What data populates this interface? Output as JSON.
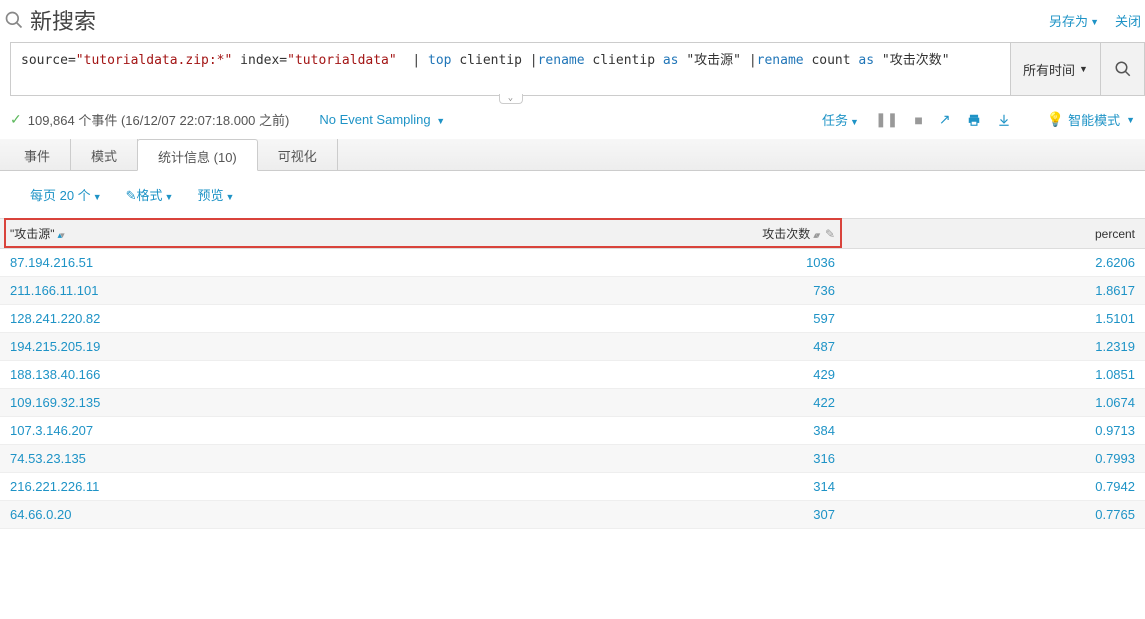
{
  "header": {
    "title": "新搜索",
    "save_as": "另存为",
    "close": "关闭"
  },
  "search": {
    "query_html": "source=<span class='kw-str'>\"tutorialdata.zip:*\"</span> index=<span class='kw-str'>\"tutorialdata\"</span>  | <span class='kw-cmd'>top</span> clientip |<span class='kw-cmd'>rename</span> clientip <span class='kw-cmd'>as</span> \"攻击源\" |<span class='kw-cmd'>rename</span> count <span class='kw-cmd'>as</span> \"攻击次数\"",
    "time_label": "所有时间"
  },
  "status": {
    "events_text": "109,864 个事件 (16/12/07 22:07:18.000 之前)",
    "sampling": "No Event Sampling",
    "tasks": "任务",
    "smart_mode": "智能模式"
  },
  "tabs": {
    "events": "事件",
    "patterns": "模式",
    "stats": "统计信息 (10)",
    "viz": "可视化"
  },
  "toolbar": {
    "per_page": "每页 20 个",
    "format": "格式",
    "preview": "预览"
  },
  "table": {
    "headers": {
      "source": "\"攻击源\"",
      "count": "攻击次数",
      "percent": "percent"
    },
    "rows": [
      {
        "source": "87.194.216.51",
        "count": "1036",
        "percent": "2.6206"
      },
      {
        "source": "211.166.11.101",
        "count": "736",
        "percent": "1.8617"
      },
      {
        "source": "128.241.220.82",
        "count": "597",
        "percent": "1.5101"
      },
      {
        "source": "194.215.205.19",
        "count": "487",
        "percent": "1.2319"
      },
      {
        "source": "188.138.40.166",
        "count": "429",
        "percent": "1.0851"
      },
      {
        "source": "109.169.32.135",
        "count": "422",
        "percent": "1.0674"
      },
      {
        "source": "107.3.146.207",
        "count": "384",
        "percent": "0.9713"
      },
      {
        "source": "74.53.23.135",
        "count": "316",
        "percent": "0.7993"
      },
      {
        "source": "216.221.226.11",
        "count": "314",
        "percent": "0.7942"
      },
      {
        "source": "64.66.0.20",
        "count": "307",
        "percent": "0.7765"
      }
    ]
  }
}
